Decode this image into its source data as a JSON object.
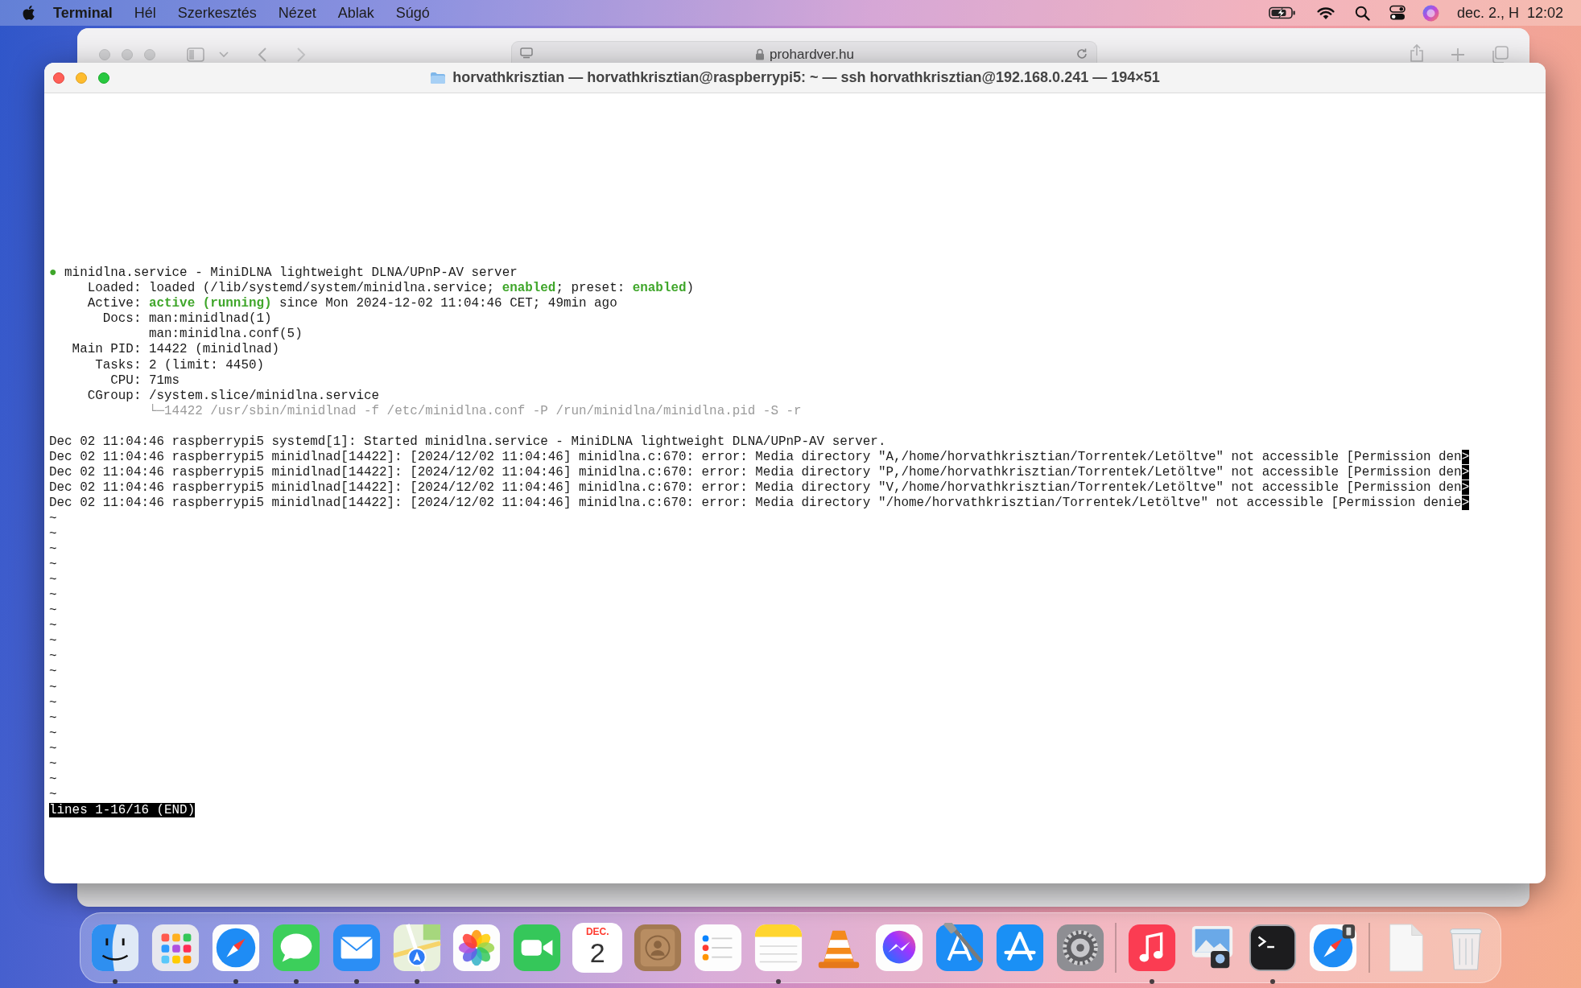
{
  "menu_bar": {
    "app": "Terminal",
    "menus": [
      "Hél",
      "Szerkesztés",
      "Nézet",
      "Ablak",
      "Súgó"
    ],
    "date": "dec. 2., H",
    "time": "12:02"
  },
  "background_window": {
    "address": "prohardver.hu"
  },
  "window": {
    "title": "horvathkrisztian — horvathkrisztian@raspberrypi5: ~ — ssh horvathkrisztian@192.168.0.241 — 194×51",
    "lines": [
      {
        "kind": "text",
        "segments": [
          {
            "text": "●",
            "kind": "green"
          },
          {
            "text": " minidlna.service - MiniDLNA lightweight DLNA/UPnP-AV server",
            "kind": "plain"
          }
        ]
      },
      {
        "kind": "text",
        "segments": [
          {
            "text": "     Loaded: loaded (/lib/systemd/system/minidlna.service; ",
            "kind": "plain"
          },
          {
            "text": "enabled",
            "kind": "green"
          },
          {
            "text": "; preset: ",
            "kind": "plain"
          },
          {
            "text": "enabled",
            "kind": "green"
          },
          {
            "text": ")",
            "kind": "plain"
          }
        ]
      },
      {
        "kind": "text",
        "segments": [
          {
            "text": "     Active: ",
            "kind": "plain"
          },
          {
            "text": "active (running)",
            "kind": "green"
          },
          {
            "text": " since Mon 2024-12-02 11:04:46 CET; 49min ago",
            "kind": "plain"
          }
        ]
      },
      {
        "kind": "text",
        "segments": [
          {
            "text": "       Docs: man:minidlnad(1)",
            "kind": "plain"
          }
        ]
      },
      {
        "kind": "text",
        "segments": [
          {
            "text": "             man:minidlna.conf(5)",
            "kind": "plain"
          }
        ]
      },
      {
        "kind": "text",
        "segments": [
          {
            "text": "   Main PID: 14422 (minidlnad)",
            "kind": "plain"
          }
        ]
      },
      {
        "kind": "text",
        "segments": [
          {
            "text": "      Tasks: 2 (limit: 4450)",
            "kind": "plain"
          }
        ]
      },
      {
        "kind": "text",
        "segments": [
          {
            "text": "        CPU: 71ms",
            "kind": "plain"
          }
        ]
      },
      {
        "kind": "text",
        "segments": [
          {
            "text": "     CGroup: /system.slice/minidlna.service",
            "kind": "plain"
          }
        ]
      },
      {
        "kind": "indented",
        "segments": [
          {
            "text": "└─14422 /usr/sbin/minidlnad -f /etc/minidlna.conf -P /run/minidlna/minidlna.pid -S -r",
            "kind": "dim"
          }
        ]
      },
      {
        "kind": "blank"
      },
      {
        "kind": "text",
        "segments": [
          {
            "text": "Dec 02 11:04:46 raspberrypi5 systemd[1]: Started minidlna.service - MiniDLNA lightweight DLNA/UPnP-AV server.",
            "kind": "plain"
          }
        ]
      },
      {
        "kind": "text",
        "segments": [
          {
            "text": "Dec 02 11:04:46 raspberrypi5 minidlnad[14422]: [2024/12/02 11:04:46] minidlna.c:670: error: Media directory \"A,/home/horvathkrisztian/Torrentek/Letöltve\" not accessible [Permission den",
            "kind": "plain"
          },
          {
            "text": ">",
            "kind": "inverse"
          }
        ]
      },
      {
        "kind": "text",
        "segments": [
          {
            "text": "Dec 02 11:04:46 raspberrypi5 minidlnad[14422]: [2024/12/02 11:04:46] minidlna.c:670: error: Media directory \"P,/home/horvathkrisztian/Torrentek/Letöltve\" not accessible [Permission den",
            "kind": "plain"
          },
          {
            "text": ">",
            "kind": "inverse"
          }
        ]
      },
      {
        "kind": "text",
        "segments": [
          {
            "text": "Dec 02 11:04:46 raspberrypi5 minidlnad[14422]: [2024/12/02 11:04:46] minidlna.c:670: error: Media directory \"V,/home/horvathkrisztian/Torrentek/Letöltve\" not accessible [Permission den",
            "kind": "plain"
          },
          {
            "text": ">",
            "kind": "inverse"
          }
        ]
      },
      {
        "kind": "text",
        "segments": [
          {
            "text": "Dec 02 11:04:46 raspberrypi5 minidlnad[14422]: [2024/12/02 11:04:46] minidlna.c:670: error: Media directory \"/home/horvathkrisztian/Torrentek/Letöltve\" not accessible [Permission denie",
            "kind": "plain"
          },
          {
            "text": ">",
            "kind": "inverse"
          }
        ]
      },
      {
        "kind": "filler",
        "text": "~"
      },
      {
        "kind": "filler",
        "text": "~"
      },
      {
        "kind": "filler",
        "text": "~"
      },
      {
        "kind": "filler",
        "text": "~"
      },
      {
        "kind": "filler",
        "text": "~"
      },
      {
        "kind": "filler",
        "text": "~"
      },
      {
        "kind": "filler",
        "text": "~"
      },
      {
        "kind": "filler",
        "text": "~"
      },
      {
        "kind": "filler",
        "text": "~"
      },
      {
        "kind": "filler",
        "text": "~"
      },
      {
        "kind": "filler",
        "text": "~"
      },
      {
        "kind": "filler",
        "text": "~"
      },
      {
        "kind": "filler",
        "text": "~"
      },
      {
        "kind": "filler",
        "text": "~"
      },
      {
        "kind": "filler",
        "text": "~"
      },
      {
        "kind": "filler",
        "text": "~"
      },
      {
        "kind": "filler",
        "text": "~"
      },
      {
        "kind": "filler",
        "text": "~"
      },
      {
        "kind": "filler",
        "text": "~"
      }
    ],
    "pager_status": "lines 1-16/16 (END)"
  },
  "dock": {
    "items": [
      {
        "kind": "finder",
        "running": true
      },
      {
        "kind": "launchpad",
        "running": false
      },
      {
        "kind": "safari",
        "running": true
      },
      {
        "kind": "messages",
        "running": true
      },
      {
        "kind": "mail",
        "running": true
      },
      {
        "kind": "maps",
        "running": true
      },
      {
        "kind": "photos",
        "running": false
      },
      {
        "kind": "facetime",
        "running": false
      },
      {
        "kind": "calendar",
        "month": "DEC.",
        "day": "2",
        "running": false
      },
      {
        "kind": "contacts",
        "running": false
      },
      {
        "kind": "reminders",
        "running": false
      },
      {
        "kind": "notes",
        "running": true
      },
      {
        "kind": "vlc",
        "running": false
      },
      {
        "kind": "messenger",
        "running": false
      },
      {
        "kind": "xcode",
        "running": false
      },
      {
        "kind": "appstore",
        "running": false
      },
      {
        "kind": "settings",
        "running": false
      },
      {
        "kind": "separator"
      },
      {
        "kind": "music",
        "running": true
      },
      {
        "kind": "preview",
        "running": false
      },
      {
        "kind": "terminal",
        "running": true
      },
      {
        "kind": "safari_tech",
        "running": false
      },
      {
        "kind": "separator"
      },
      {
        "kind": "document",
        "running": false
      },
      {
        "kind": "trash",
        "running": false
      }
    ]
  }
}
